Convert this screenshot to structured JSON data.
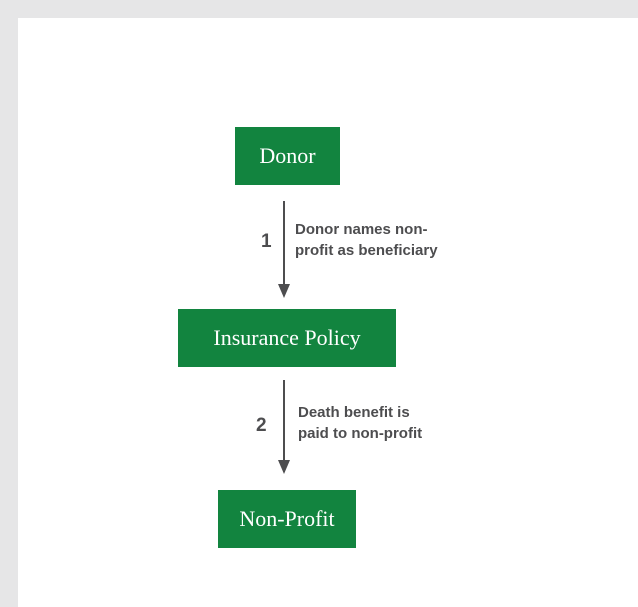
{
  "nodes": {
    "donor": "Donor",
    "policy": "Insurance Policy",
    "nonprofit": "Non-Profit"
  },
  "steps": [
    {
      "number": "1",
      "lines": [
        "Donor names non-",
        "profit as beneficiary"
      ]
    },
    {
      "number": "2",
      "lines": [
        "Death benefit is",
        "paid to non-profit"
      ]
    }
  ],
  "colors": {
    "node_fill": "#12843f",
    "node_text": "#ffffff",
    "connector": "#4d4d4f",
    "label_text": "#4d4d4f",
    "background": "#e6e6e7",
    "panel": "#ffffff"
  }
}
